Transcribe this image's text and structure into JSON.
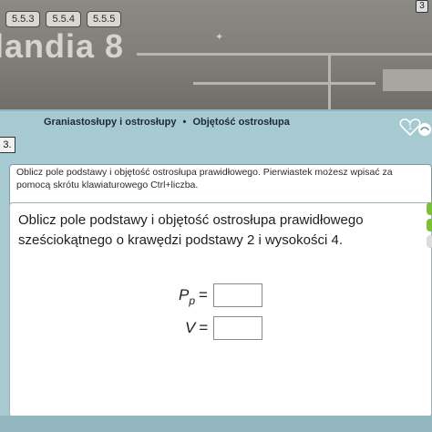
{
  "version_tabs": [
    "5.5.3",
    "5.5.4",
    "5.5.5"
  ],
  "top_right_badge": "3",
  "background_title": "landia 8",
  "breadcrumb": {
    "part1": "Graniastosłupy i ostrosłupy",
    "separator": "•",
    "part2": "Objętość ostrosłupa"
  },
  "task_number": "3.",
  "hearts_count": "1",
  "instruction": "Oblicz pole podstawy i objętość ostrosłupa prawidłowego. Pierwiastek możesz wpisać za pomocą skrótu klawiaturowego Ctrl+liczba.",
  "problem": {
    "line1": "Oblicz pole podstawy i objętość ostrosłupa prawidłowego",
    "line2": "sześciokątnego o krawędzi podstawy 2 i wysokości 4."
  },
  "formulas": {
    "base_area": {
      "symbol": "P",
      "subscript": "p",
      "equals": "=",
      "value": ""
    },
    "volume": {
      "symbol": "V",
      "equals": "=",
      "value": ""
    }
  },
  "colors": {
    "panel": "#a7c9d2",
    "accent_green": "#7bbf3a",
    "heart_outline": "#ffffff"
  }
}
